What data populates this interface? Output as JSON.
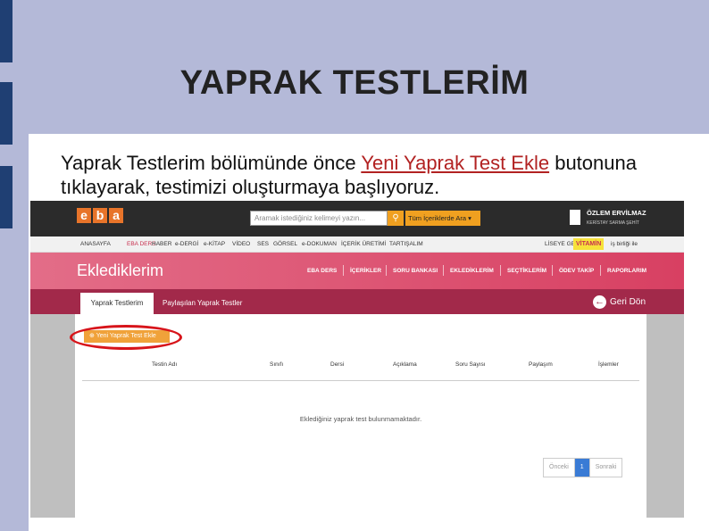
{
  "slide": {
    "title": "YAPRAK TESTLERİM",
    "intro_before": "Yaprak Testlerim bölümünde önce ",
    "intro_link": "Yeni Yaprak Test Ekle",
    "intro_after": " butonuna tıklayarak, testimizi oluşturmaya başlıyoruz."
  },
  "app": {
    "logo_letters": [
      "e",
      "b",
      "a"
    ],
    "search_placeholder": "Aramak istediğiniz kelimeyi yazın...",
    "search_icon": "search-icon",
    "search_scope": "Tüm İçeriklerde Ara",
    "user_name": "ÖZLEM ERVİLMAZ",
    "user_school": "KERİSTAY SARMA ŞEHİT",
    "nav_items": [
      "ANASAYFA",
      "EBA DERS",
      "HABER",
      "e-DERGİ",
      "e-KİTAP",
      "VİDEO",
      "SES",
      "GÖRSEL",
      "e-DOKUMAN",
      "İÇERİK ÜRETİMİ",
      "TARTIŞALIM"
    ],
    "nav_right": [
      "LİSEYE GEÇ"
    ],
    "vitamin_label": "VİTAMİN",
    "nav_extra": "iş birliği ile",
    "page_title": "Eklediklerim",
    "page_nav": [
      "EBA DERS",
      "İÇERİKLER",
      "SORU BANKASI",
      "EKLEDİKLERİM",
      "SEÇTİKLERİM",
      "ÖDEV TAKİP",
      "RAPORLARIM"
    ],
    "tabs": [
      "Yaprak Testlerim",
      "Paylaşılan Yaprak Testler"
    ],
    "back_label": "Geri Dön",
    "add_button": "Yeni Yaprak Test Ekle",
    "columns": [
      "Testin Adı",
      "Sınıfı",
      "Dersi",
      "Açıklama",
      "Soru Sayısı",
      "Paylaşım",
      "İşlemler"
    ],
    "empty_message": "Eklediğiniz yaprak test bulunmamaktadır.",
    "pager": {
      "prev": "Önceki",
      "current": "1",
      "next": "Sonraki"
    }
  },
  "colors": {
    "slide_bg": "#b4b9d8",
    "accent_bar": "#1f3f73",
    "link": "#b22222",
    "eba_orange": "#e8742a",
    "pink": "#d84062",
    "tab_bar": "#a2294a",
    "highlight": "#d7141a"
  }
}
